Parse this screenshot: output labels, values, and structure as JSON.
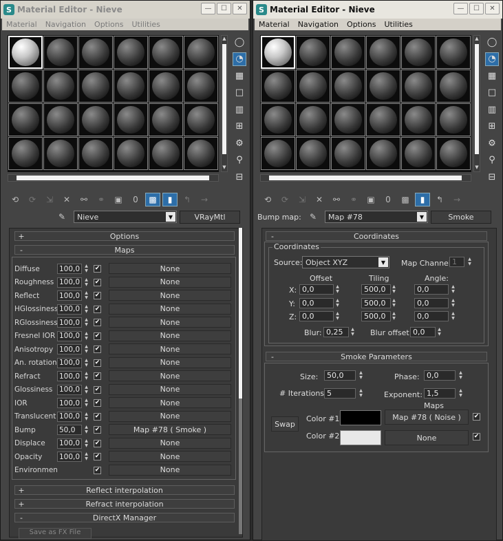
{
  "left": {
    "title": "Material Editor - Nieve",
    "menu": [
      "Material",
      "Navigation",
      "Options",
      "Utilities"
    ],
    "material_name": "Nieve",
    "material_type": "VRayMtl",
    "sample_slots": 24,
    "toolbar_digit": "0",
    "rollouts": {
      "options": {
        "sign": "+",
        "label": "Options"
      },
      "maps": {
        "sign": "-",
        "label": "Maps"
      },
      "reflect_interp": {
        "sign": "+",
        "label": "Reflect interpolation"
      },
      "refract_interp": {
        "sign": "+",
        "label": "Refract interpolation"
      },
      "directx": {
        "sign": "-",
        "label": "DirectX Manager"
      }
    },
    "maps": [
      {
        "label": "Diffuse",
        "amount": "100,0",
        "checked": true,
        "map": "None"
      },
      {
        "label": "Roughness",
        "amount": "100,0",
        "checked": true,
        "map": "None"
      },
      {
        "label": "Reflect",
        "amount": "100,0",
        "checked": true,
        "map": "None"
      },
      {
        "label": "HGlossiness",
        "amount": "100,0",
        "checked": true,
        "map": "None"
      },
      {
        "label": "RGlossiness",
        "amount": "100,0",
        "checked": true,
        "map": "None"
      },
      {
        "label": "Fresnel IOR",
        "amount": "100,0",
        "checked": true,
        "map": "None"
      },
      {
        "label": "Anisotropy",
        "amount": "100,0",
        "checked": true,
        "map": "None"
      },
      {
        "label": "An. rotation",
        "amount": "100,0",
        "checked": true,
        "map": "None"
      },
      {
        "label": "Refract",
        "amount": "100,0",
        "checked": true,
        "map": "None"
      },
      {
        "label": "Glossiness",
        "amount": "100,0",
        "checked": true,
        "map": "None"
      },
      {
        "label": "IOR",
        "amount": "100,0",
        "checked": true,
        "map": "None"
      },
      {
        "label": "Translucent",
        "amount": "100,0",
        "checked": true,
        "map": "None"
      },
      {
        "label": "Bump",
        "amount": "50,0",
        "checked": true,
        "map": "Map #78  ( Smoke )"
      },
      {
        "label": "Displace",
        "amount": "100,0",
        "checked": true,
        "map": "None"
      },
      {
        "label": "Opacity",
        "amount": "100,0",
        "checked": true,
        "map": "None"
      },
      {
        "label": "Environment",
        "amount": "",
        "checked": true,
        "map": "None"
      }
    ],
    "bottom_button": "Save as FX File"
  },
  "right": {
    "title": "Material Editor - Nieve",
    "menu": [
      "Material",
      "Navigation",
      "Options",
      "Utilities"
    ],
    "slot_label": "Bump map:",
    "map_name": "Map #78",
    "map_type": "Smoke",
    "toolbar_digit": "0",
    "coordinates": {
      "rollout_sign": "-",
      "rollout_label": "Coordinates",
      "group_label": "Coordinates",
      "source_label": "Source:",
      "source_value": "Object XYZ",
      "channel_label": "Map Channel:",
      "channel_value": "1",
      "offset_label": "Offset",
      "tiling_label": "Tiling",
      "angle_label": "Angle:",
      "rows": [
        {
          "axis": "X:",
          "offset": "0,0",
          "tiling": "500,0",
          "angle": "0,0"
        },
        {
          "axis": "Y:",
          "offset": "0,0",
          "tiling": "500,0",
          "angle": "0,0"
        },
        {
          "axis": "Z:",
          "offset": "0,0",
          "tiling": "500,0",
          "angle": "0,0"
        }
      ],
      "blur_label": "Blur:",
      "blur_value": "0,25",
      "blur_offset_label": "Blur offset:",
      "blur_offset_value": "0,0"
    },
    "smoke": {
      "rollout_sign": "-",
      "rollout_label": "Smoke Parameters",
      "size_label": "Size:",
      "size_value": "50,0",
      "phase_label": "Phase:",
      "phase_value": "0,0",
      "iterations_label": "# Iterations:",
      "iterations_value": "5",
      "exponent_label": "Exponent:",
      "exponent_value": "1,5",
      "maps_label": "Maps",
      "swap_label": "Swap",
      "color1_label": "Color #1",
      "color1": "#000000",
      "color1_map": "Map #78  ( Noise )",
      "color2_label": "Color #2",
      "color2": "#e8e8e8",
      "color2_map": "None"
    }
  },
  "icons": {
    "close": "✕",
    "min": "—",
    "max": "☐",
    "check": "✔",
    "caret": "▼",
    "up": "▲",
    "down": "▼"
  }
}
